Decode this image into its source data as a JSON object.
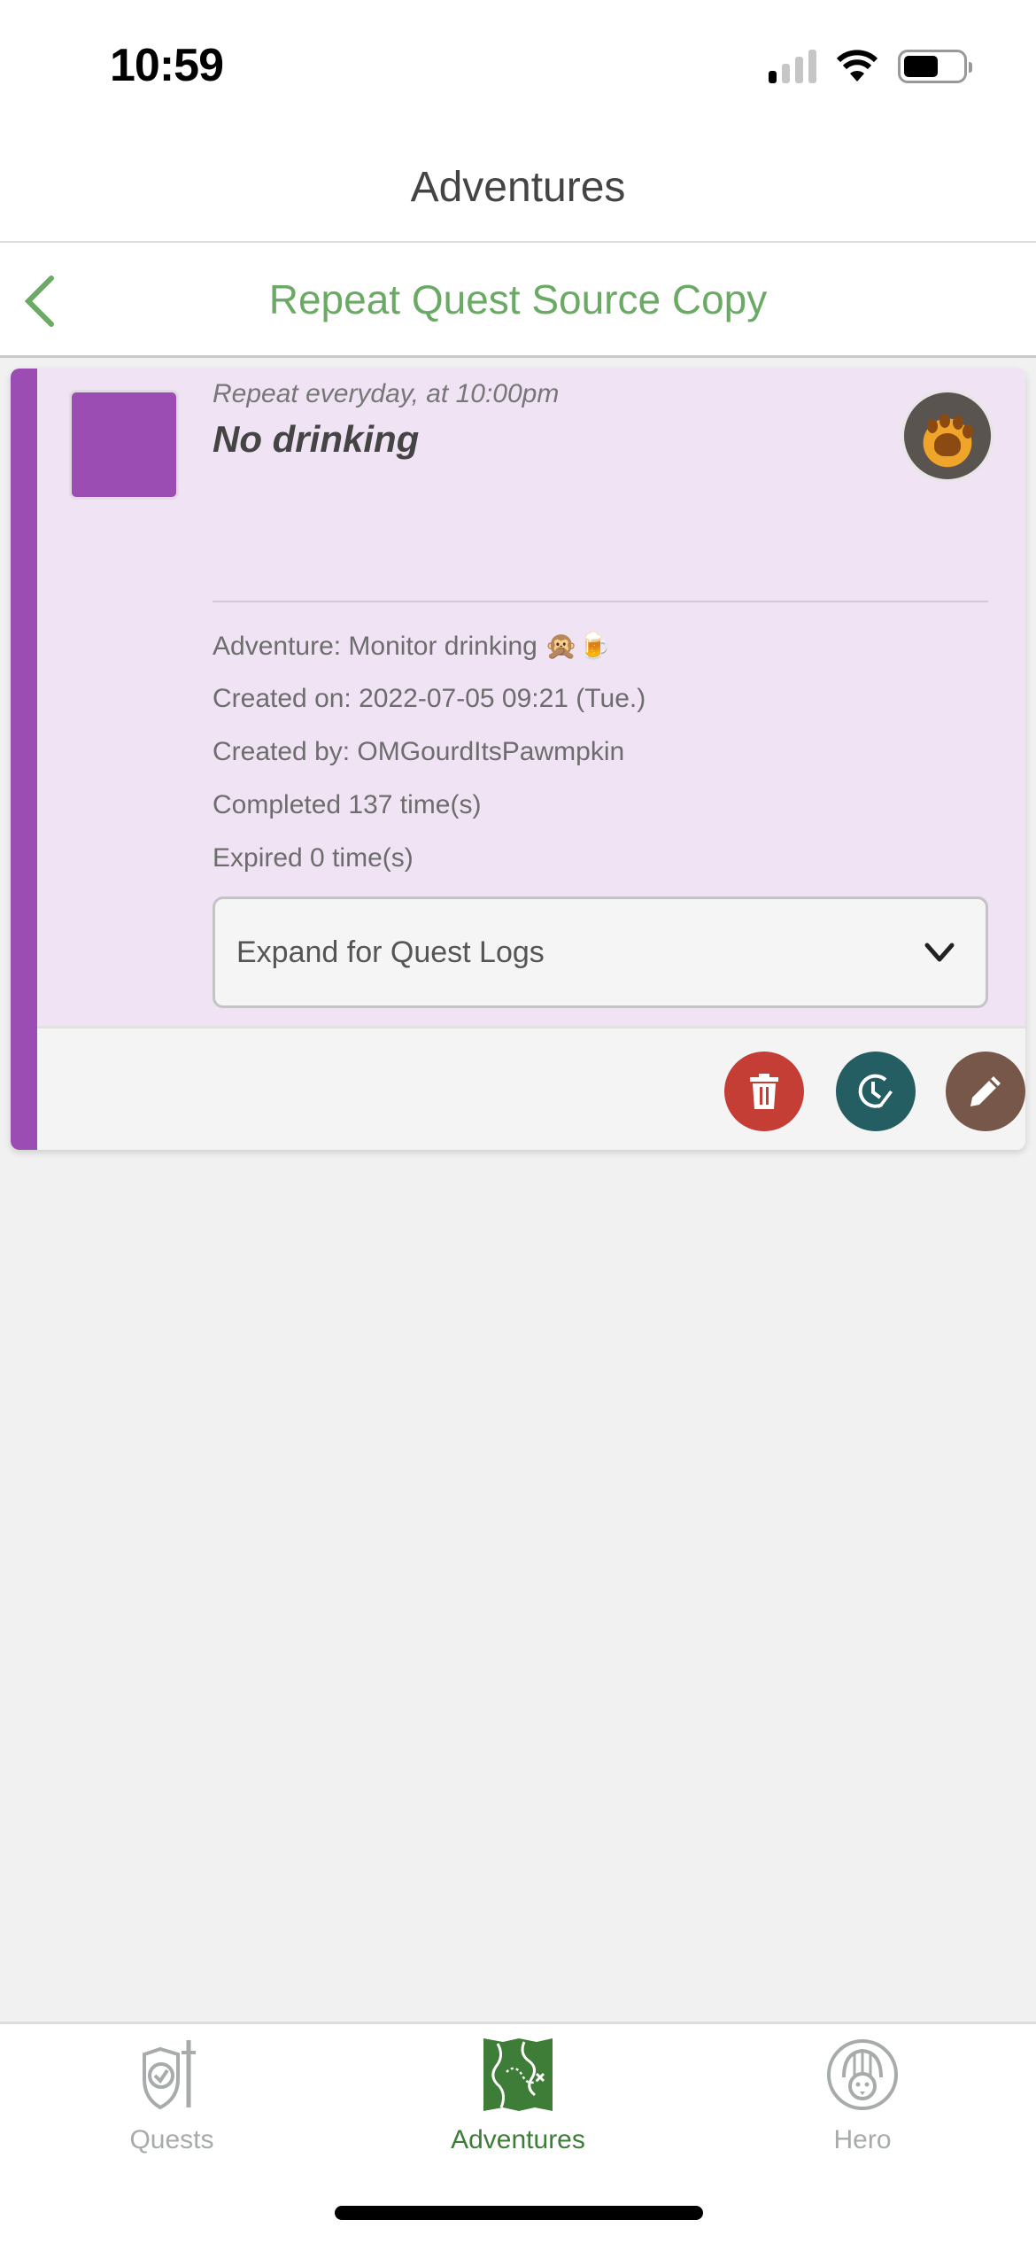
{
  "status_bar": {
    "time": "10:59",
    "signal_bars": 1,
    "battery_level": 0.6
  },
  "header": {
    "title": "Adventures"
  },
  "sub_header": {
    "title": "Repeat Quest Source Copy",
    "back_icon": "chevron-left-icon"
  },
  "quest_card": {
    "accent_color": "#9b4db4",
    "background_color": "#efe3f4",
    "repeat_text": "Repeat everyday, at 10:00pm",
    "title": "No drinking",
    "avatar": "pumpkin-avatar",
    "details": [
      "Adventure: Monitor drinking 🙊🍺",
      "Created on: 2022-07-05 09:21 (Tue.)",
      "Created by: OMGourdItsPawmpkin",
      "Completed 137 time(s)",
      "Expired 0 time(s)"
    ],
    "expander_label": "Expand for Quest Logs",
    "actions": [
      {
        "name": "delete",
        "icon": "trash-icon",
        "color": "#c43e36"
      },
      {
        "name": "schedule",
        "icon": "clock-edit-icon",
        "color": "#245e63"
      },
      {
        "name": "edit",
        "icon": "pencil-icon",
        "color": "#76574a"
      }
    ]
  },
  "bottom_nav": {
    "active": "Adventures",
    "active_color": "#3e7d37",
    "items": [
      {
        "label": "Quests",
        "icon": "shield-sword-icon"
      },
      {
        "label": "Adventures",
        "icon": "treasure-map-icon"
      },
      {
        "label": "Hero",
        "icon": "knight-helmet-icon"
      }
    ]
  }
}
